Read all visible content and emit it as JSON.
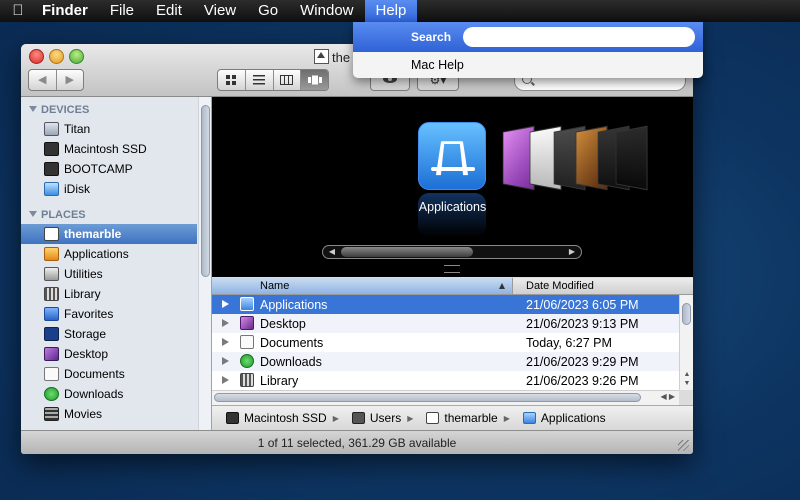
{
  "menubar": {
    "apple_icon": "apple-logo-icon",
    "items": [
      "Finder",
      "File",
      "Edit",
      "View",
      "Go",
      "Window",
      "Help"
    ],
    "active": "Help"
  },
  "help_menu": {
    "search_label": "Search",
    "search_value": "",
    "items": [
      "Mac Help"
    ]
  },
  "window": {
    "title": "the",
    "sidebar": {
      "devices_header": "DEVICES",
      "devices": [
        {
          "label": "Titan",
          "icon": "computer-icon"
        },
        {
          "label": "Macintosh SSD",
          "icon": "hard-drive-icon"
        },
        {
          "label": "BOOTCAMP",
          "icon": "hard-drive-icon"
        },
        {
          "label": "iDisk",
          "icon": "idisk-icon"
        }
      ],
      "places_header": "PLACES",
      "places": [
        {
          "label": "themarble",
          "icon": "home-icon",
          "selected": true
        },
        {
          "label": "Applications",
          "icon": "applications-icon"
        },
        {
          "label": "Utilities",
          "icon": "utilities-icon"
        },
        {
          "label": "Library",
          "icon": "library-icon"
        },
        {
          "label": "Favorites",
          "icon": "favorites-icon"
        },
        {
          "label": "Storage",
          "icon": "storage-icon"
        },
        {
          "label": "Desktop",
          "icon": "desktop-icon"
        },
        {
          "label": "Documents",
          "icon": "documents-icon"
        },
        {
          "label": "Downloads",
          "icon": "downloads-icon"
        },
        {
          "label": "Movies",
          "icon": "movies-icon"
        }
      ]
    },
    "coverflow": {
      "selected_label": "Applications"
    },
    "list": {
      "columns": [
        "Name",
        "Date Modified"
      ],
      "rows": [
        {
          "name": "Applications",
          "date": "21/06/2023 6:05 PM",
          "selected": true
        },
        {
          "name": "Desktop",
          "date": "21/06/2023 9:13 PM"
        },
        {
          "name": "Documents",
          "date": "Today, 6:27 PM"
        },
        {
          "name": "Downloads",
          "date": "21/06/2023 9:29 PM"
        },
        {
          "name": "Library",
          "date": "21/06/2023 9:26 PM"
        }
      ]
    },
    "pathbar": [
      "Macintosh SSD",
      "Users",
      "themarble",
      "Applications"
    ],
    "status": "1 of 11 selected, 361.29 GB available"
  },
  "colors": {
    "selection": "#3875d7",
    "menu_highlight": "#3d72e0",
    "desktop": "#0d3461"
  }
}
